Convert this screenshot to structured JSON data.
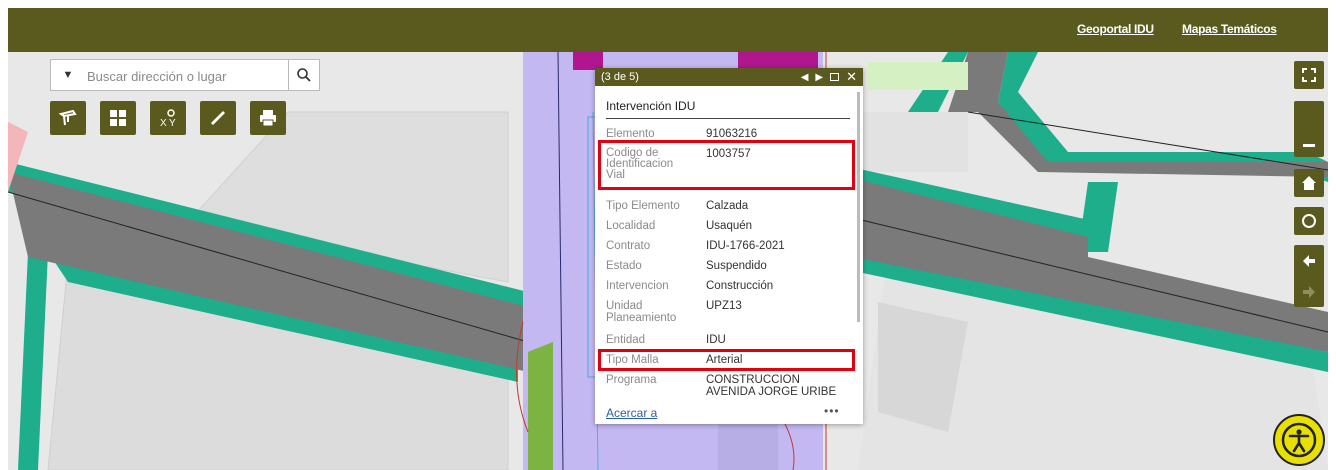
{
  "header": {
    "links": [
      {
        "label": "Geoportal IDU"
      },
      {
        "label": "Mapas Temáticos"
      }
    ]
  },
  "search": {
    "placeholder": "Buscar dirección o lugar",
    "dropdown_icon": "caret-down-icon",
    "search_icon": "magnifier-icon"
  },
  "toolbar": {
    "tools": [
      "layers-icon",
      "basemap-grid-icon",
      "coordinates-icon",
      "measure-icon",
      "print-icon"
    ]
  },
  "map_controls": [
    "fullscreen-icon",
    "zoom-out-icon",
    "home-icon",
    "locate-icon",
    "back-arrow-icon",
    "forward-arrow-icon"
  ],
  "popup": {
    "pager": "(3 de 5)",
    "title": "Intervención IDU",
    "fields": [
      {
        "label": "Elemento",
        "value": "91063216"
      },
      {
        "label": "Codigo de Identificacion Vial",
        "value": "1003757"
      },
      {
        "label": "Tipo Elemento",
        "value": "Calzada"
      },
      {
        "label": "Localidad",
        "value": "Usaquén"
      },
      {
        "label": "Contrato",
        "value": "IDU-1766-2021"
      },
      {
        "label": "Estado",
        "value": "Suspendido"
      },
      {
        "label": "Intervencion",
        "value": "Construcción"
      },
      {
        "label": "Unidad Planeamiento",
        "value": "UPZ13"
      },
      {
        "label": "Entidad",
        "value": "IDU"
      },
      {
        "label": "Tipo Malla",
        "value": "Arterial"
      },
      {
        "label": "Programa",
        "value": "CONSTRUCCION AVENIDA JORGE URIBE"
      }
    ],
    "zoom_link": "Acercar a",
    "more": "•••"
  },
  "colors": {
    "brand": "#5a5a1f",
    "road": "#7a7a7a",
    "sidewalk": "#1fae8c",
    "lane_purple": "#c4b8f2",
    "highlight_red": "#e0000f",
    "accessibility": "#e8e000"
  }
}
